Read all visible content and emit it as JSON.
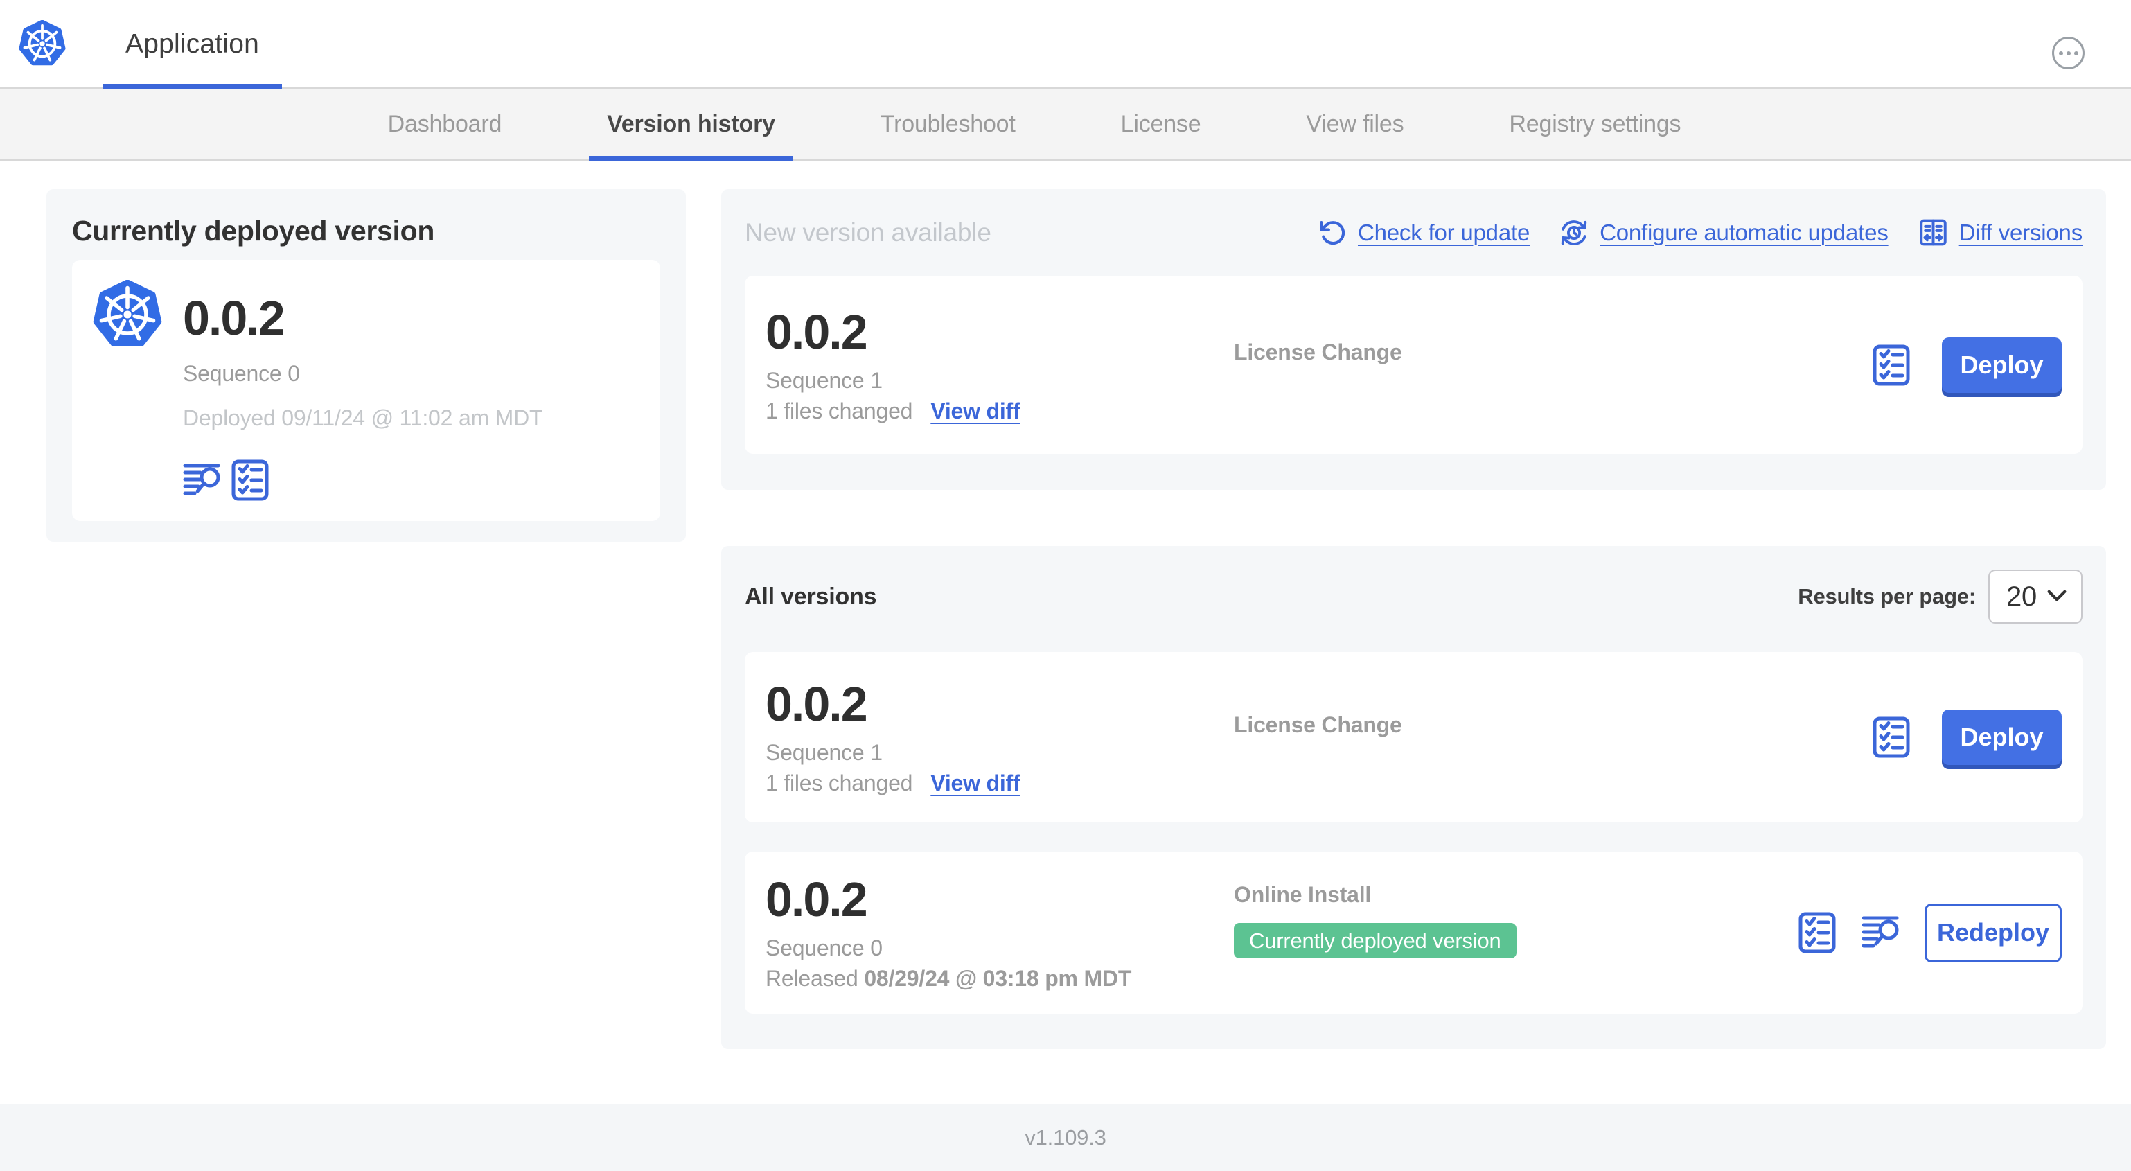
{
  "colors": {
    "accent_blue": "#3b66d9",
    "button_blue": "#4370e4",
    "button_blue_shadow": "#3157bb",
    "kubernetes_blue": "#326ce5",
    "badge_green": "#5cc392",
    "nav_bar_bg": "#f4f4f4",
    "panel_bg": "#f5f7f9",
    "border_gray": "#d8d8d8"
  },
  "header": {
    "app_tab_label": "Application"
  },
  "nav": {
    "tabs": [
      "Dashboard",
      "Version history",
      "Troubleshoot",
      "License",
      "View files",
      "Registry settings"
    ],
    "active_tab": "Version history"
  },
  "deployed_panel": {
    "title": "Currently deployed version",
    "version": "0.0.2",
    "sequence": "Sequence 0",
    "deployed_at": "Deployed 09/11/24 @ 11:02 am MDT"
  },
  "new_version_panel": {
    "title": "New version available",
    "check_for_update_label": "Check for update",
    "configure_updates_label": "Configure automatic updates",
    "diff_versions_label": "Diff versions",
    "card": {
      "version": "0.0.2",
      "sequence": "Sequence 1",
      "files_changed": "1 files changed",
      "view_diff_label": "View diff",
      "release_notes": "License Change",
      "deploy_label": "Deploy"
    }
  },
  "all_versions_panel": {
    "title": "All versions",
    "results_per_page_label": "Results per page:",
    "results_per_page_value": "20",
    "row1": {
      "version": "0.0.2",
      "sequence": "Sequence 1",
      "files_changed": "1 files changed",
      "view_diff_label": "View diff",
      "release_notes": "License Change",
      "deploy_label": "Deploy"
    },
    "row2": {
      "version": "0.0.2",
      "sequence": "Sequence 0",
      "released_prefix": "Released",
      "released_date": "08/29/24 @ 03:18 pm MDT",
      "source": "Online Install",
      "badge": "Currently deployed version",
      "redeploy_label": "Redeploy"
    }
  },
  "footer": {
    "console_version": "v1.109.3"
  }
}
